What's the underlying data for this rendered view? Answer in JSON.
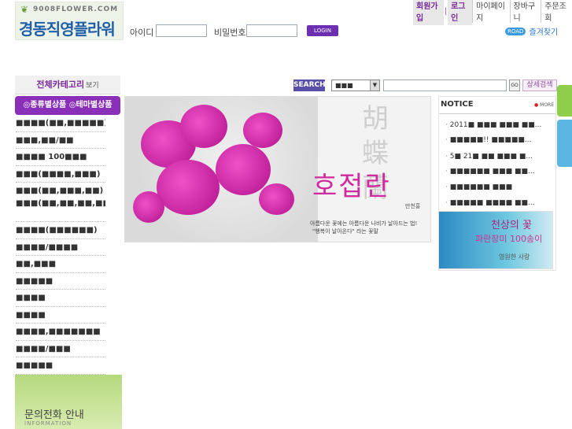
{
  "logo": {
    "domain": "9008FLOWER.COM",
    "name": "경동직영플라워"
  },
  "login": {
    "id_label": "아이디",
    "pw_label": "비밀번호",
    "button": "LOGIN"
  },
  "top_links": [
    "회원가입",
    "로그인",
    "마이페이지",
    "장바구니",
    "주문조회"
  ],
  "favorite": {
    "badge": "ROAD",
    "label": "즐겨찾기"
  },
  "category": {
    "header": "전체카테고리",
    "header_sub": "보기",
    "tabs": "◎종류별상품 ◎테마별상품",
    "items": [
      "■■■■(■■,■■■■■)",
      "■■■,■■/■■",
      "■■■■ 100■■■",
      "■■■(■■■■,■■■)",
      "■■■(■■,■■■,■■)",
      "■■■(■■,■■,■■,■■)",
      "■■■■(■■■■■■)",
      "■■■■/■■■■",
      "■■,■■■",
      "■■■■■",
      "■■■■",
      "■■■■",
      "■■■■,■■■■■■■",
      "■■■■/■■■",
      "■■■■■"
    ],
    "inquiry_title": "문의전화 안내",
    "inquiry_sub": "INFORMATION"
  },
  "search": {
    "label": "SEARCH",
    "select_value": "■■■",
    "go_label": "GO",
    "advanced_label": "상세검색"
  },
  "banner": {
    "hanja": [
      "胡",
      "蝶",
      "蘭"
    ],
    "title": "호접란",
    "title_sub": "만천홍",
    "caption1": "아름다운 꽃에는 아름다운 나비가 날아드는 법!",
    "caption2": "\"행복이 날아온다\" 라는 꽃말"
  },
  "notice": {
    "title": "NOTICE",
    "more": "MORE",
    "items": [
      "2011■ ■■■ ■■■ ■■...",
      "■■■■■!! ■■■■■...",
      "5■ 21■ ■■ ■■■ ■...",
      "■■■■■■ ■■■ ■■...",
      "■■■■■■ ■■■",
      "■■■■■ ■■■■ ■■..."
    ]
  },
  "promo": {
    "line1": "천상의 꽃",
    "line2": "파란장미 100송이",
    "line3": "영원한 사랑"
  }
}
